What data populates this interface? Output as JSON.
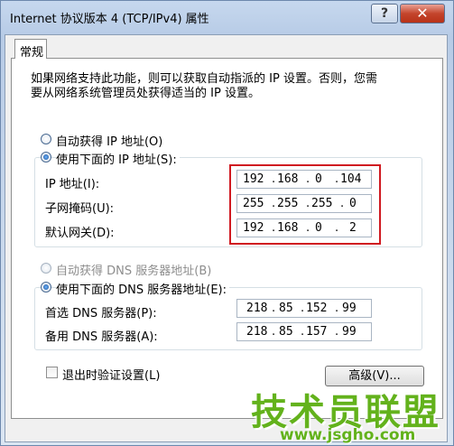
{
  "window": {
    "title": "Internet 协议版本 4 (TCP/IPv4) 属性",
    "help_glyph": "?",
    "close_glyph": "✕"
  },
  "tabs": [
    {
      "label": "常规"
    }
  ],
  "description": {
    "line1": "如果网络支持此功能，则可以获取自动指派的 IP 设置。否则，您需",
    "line2": "要从网络系统管理员处获得适当的 IP 设置。"
  },
  "ip": {
    "auto_label": "自动获得 IP 地址(O)",
    "manual_label": "使用下面的 IP 地址(S):",
    "selected": "manual",
    "fields": [
      {
        "label": "IP 地址(I):",
        "octets": [
          "192",
          "168",
          "0",
          "104"
        ]
      },
      {
        "label": "子网掩码(U):",
        "octets": [
          "255",
          "255",
          "255",
          "0"
        ]
      },
      {
        "label": "默认网关(D):",
        "octets": [
          "192",
          "168",
          "0",
          "2"
        ]
      }
    ]
  },
  "dns": {
    "auto_label": "自动获得 DNS 服务器地址(B)",
    "manual_label": "使用下面的 DNS 服务器地址(E):",
    "selected": "manual",
    "fields": [
      {
        "label": "首选 DNS 服务器(P):",
        "octets": [
          "218",
          "85",
          "152",
          "99"
        ]
      },
      {
        "label": "备用 DNS 服务器(A):",
        "octets": [
          "218",
          "85",
          "157",
          "99"
        ]
      }
    ]
  },
  "validate": {
    "label": "退出时验证设置(L)",
    "checked": false
  },
  "advanced_button": "高级(V)...",
  "watermark": {
    "brand": "技术员联盟",
    "url": "www.jsgho.com"
  },
  "colors": {
    "highlight_box": "#d01a21",
    "watermark": "#63b21c"
  }
}
